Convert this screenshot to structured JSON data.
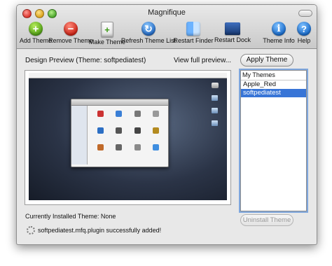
{
  "window": {
    "title": "Magnifique"
  },
  "toolbar": {
    "items": [
      {
        "label": "Add Theme",
        "icon": "plus-circle-icon"
      },
      {
        "label": "Remove Theme",
        "icon": "minus-circle-icon"
      },
      {
        "label": "Make Theme",
        "icon": "document-plus-icon"
      },
      {
        "label": "Refresh Theme List",
        "icon": "refresh-icon"
      },
      {
        "label": "Restart Finder",
        "icon": "finder-icon"
      },
      {
        "label": "Restart Dock",
        "icon": "dock-icon"
      },
      {
        "label": "Theme Info",
        "icon": "info-icon"
      },
      {
        "label": "Help",
        "icon": "help-icon"
      }
    ]
  },
  "preview": {
    "heading": "Design Preview (Theme: softpediatest)",
    "view_full_link": "View full preview..."
  },
  "apply_button": "Apply Theme",
  "themes": {
    "header": "My Themes",
    "items": [
      {
        "label": "Apple_Red",
        "selected": false
      },
      {
        "label": "softpediatest",
        "selected": true
      }
    ]
  },
  "installed_theme": "Currently Installed Theme: None",
  "uninstall_button": "Uninstall Theme",
  "status_message": "softpediatest.mfq.plugin successfully added!",
  "colors": {
    "selection": "#3875d7",
    "window_bg": "#e8e8e8"
  }
}
